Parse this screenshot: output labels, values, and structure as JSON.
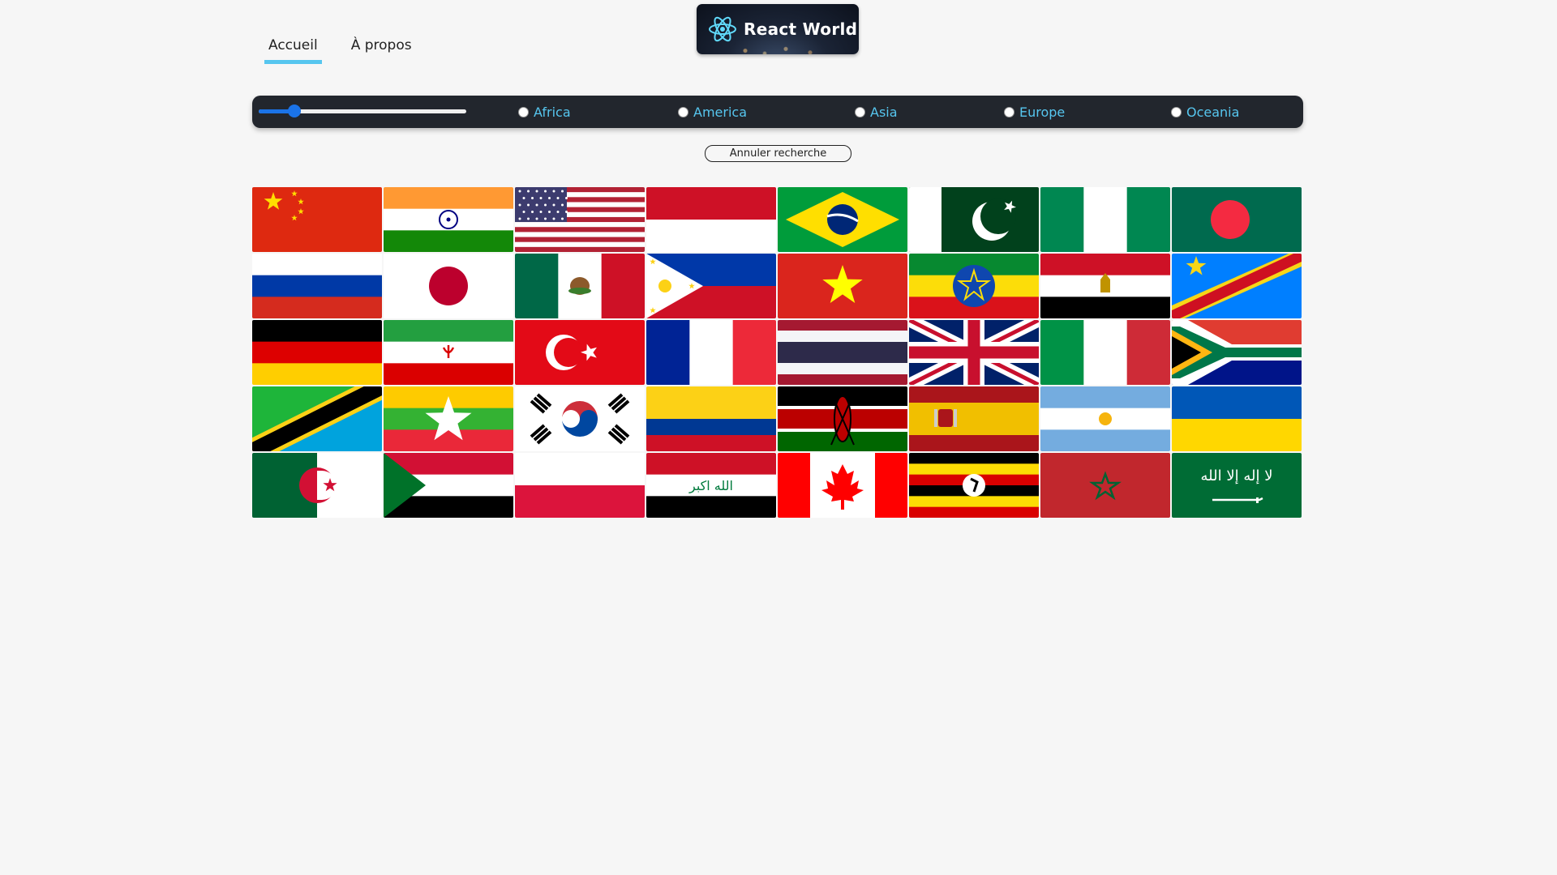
{
  "nav": {
    "home_label": "Accueil",
    "about_label": "À propos"
  },
  "logo": {
    "text": "React World"
  },
  "filters": {
    "population_slider": {
      "value_fraction": 0.17
    },
    "regions": [
      "Africa",
      "America",
      "Asia",
      "Europe",
      "Oceania"
    ]
  },
  "reset_label": "Annuler recherche",
  "flags": [
    "china",
    "india",
    "united-states",
    "indonesia",
    "brazil",
    "pakistan",
    "nigeria",
    "bangladesh",
    "russia",
    "japan",
    "mexico",
    "philippines",
    "vietnam",
    "ethiopia",
    "egypt",
    "dr-congo",
    "germany",
    "iran",
    "turkey",
    "france",
    "thailand",
    "united-kingdom",
    "italy",
    "south-africa",
    "tanzania",
    "myanmar",
    "south-korea",
    "colombia",
    "kenya",
    "spain",
    "argentina",
    "ukraine",
    "algeria",
    "sudan",
    "poland",
    "iraq",
    "canada",
    "uganda",
    "morocco",
    "saudi-arabia"
  ],
  "colors": {
    "accent": "#56c6ef",
    "slider": "#1a73e8",
    "bar": "#22262d",
    "background": "#f6f6f6"
  }
}
